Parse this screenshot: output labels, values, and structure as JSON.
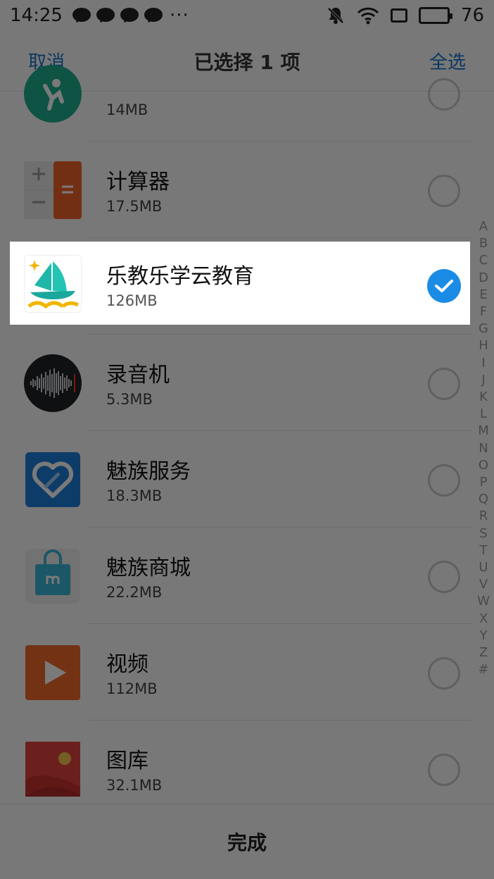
{
  "status_bar": {
    "time": "14:25",
    "dots": "···",
    "battery_level": "76"
  },
  "header": {
    "cancel_label": "取消",
    "title": "已选择 1 项",
    "select_all_label": "全选"
  },
  "apps": [
    {
      "name": "",
      "size": "14MB",
      "icon": "fitness-icon",
      "selected": false
    },
    {
      "name": "计算器",
      "size": "17.5MB",
      "icon": "calculator-icon",
      "selected": false
    },
    {
      "name": "乐教乐学云教育",
      "size": "126MB",
      "icon": "sailboat-icon",
      "selected": true
    },
    {
      "name": "录音机",
      "size": "5.3MB",
      "icon": "recorder-icon",
      "selected": false
    },
    {
      "name": "魅族服务",
      "size": "18.3MB",
      "icon": "heart-icon",
      "selected": false
    },
    {
      "name": "魅族商城",
      "size": "22.2MB",
      "icon": "shopping-bag-icon",
      "selected": false
    },
    {
      "name": "视频",
      "size": "112MB",
      "icon": "play-icon",
      "selected": false
    },
    {
      "name": "图库",
      "size": "32.1MB",
      "icon": "gallery-icon",
      "selected": false
    }
  ],
  "alphabet": [
    "A",
    "B",
    "C",
    "D",
    "E",
    "F",
    "G",
    "H",
    "I",
    "J",
    "K",
    "L",
    "M",
    "N",
    "O",
    "P",
    "Q",
    "R",
    "S",
    "T",
    "U",
    "V",
    "W",
    "X",
    "Y",
    "Z",
    "#"
  ],
  "bottom_bar": {
    "done_label": "完成"
  },
  "colors": {
    "accent": "#1a73c8",
    "check": "#1a8ce6"
  }
}
